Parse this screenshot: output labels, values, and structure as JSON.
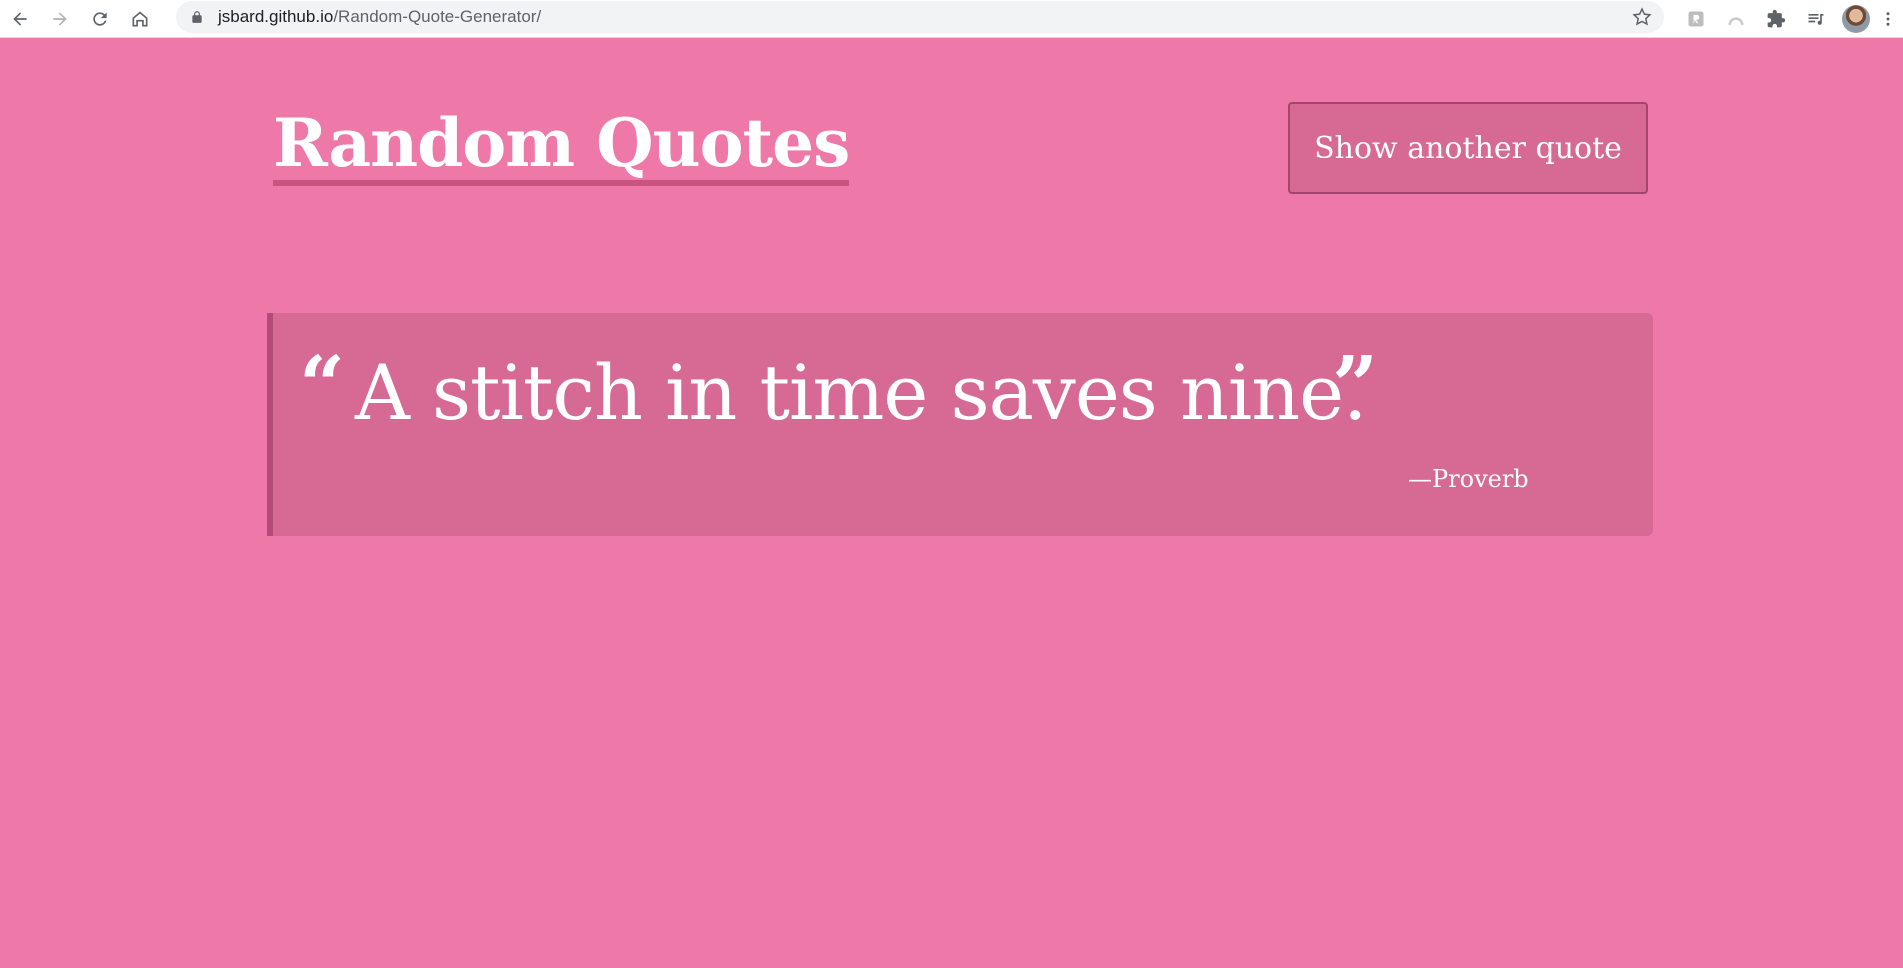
{
  "browser": {
    "url_host": "jsbard.github.io",
    "url_path": "/Random-Quote-Generator/"
  },
  "header": {
    "title": "Random Quotes",
    "button_label": "Show another quote"
  },
  "quote": {
    "open_mark": "“",
    "text": "A stitch in time saves nine.",
    "close_mark": "”",
    "source": "—Proverb"
  },
  "colors": {
    "background": "#ee78a8",
    "card": "#d66a95",
    "accent_border": "#b24b77",
    "text": "#ffffff"
  }
}
